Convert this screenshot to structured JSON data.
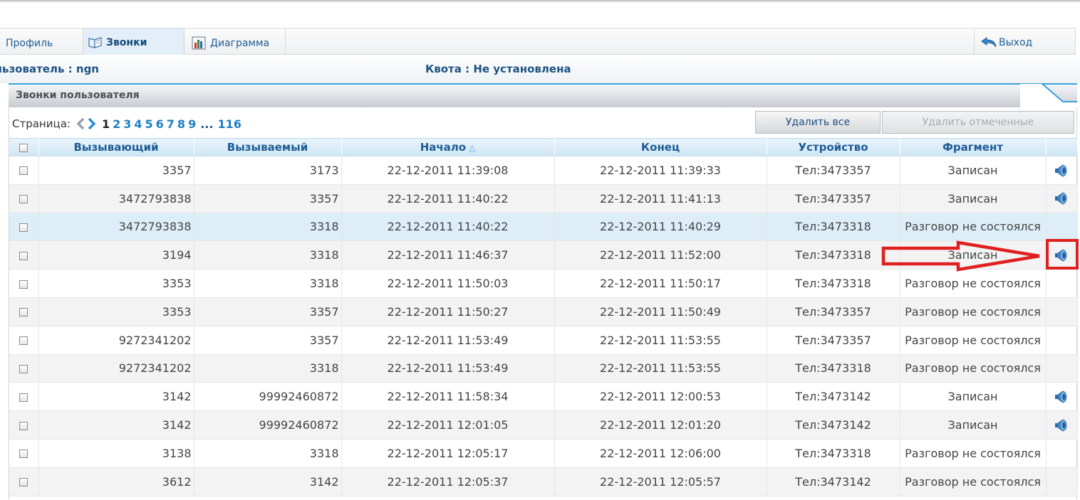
{
  "tabs": {
    "profile": "Профиль",
    "calls": "Звонки",
    "chart": "Диаграмма",
    "exit": "Выход"
  },
  "info": {
    "user": "льзователь : ngn",
    "quota": "Квота : Не установлена"
  },
  "panel": {
    "title": "Звонки пользователя"
  },
  "pager": {
    "label": "Страница:",
    "current": "1",
    "pages": [
      "2",
      "3",
      "4",
      "5",
      "6",
      "7",
      "8",
      "9"
    ],
    "dots": "...",
    "last": "116"
  },
  "buttons": {
    "delete_all": "Удалить все",
    "delete_checked": "Удалить отмеченные"
  },
  "table": {
    "headers": {
      "caller": "Вызывающий",
      "callee": "Вызываемый",
      "start": "Начало",
      "start_sort": "△",
      "end": "Конец",
      "device": "Устройство",
      "fragment": "Фрагмент"
    },
    "rows": [
      {
        "caller": "3357",
        "callee": "3173",
        "start": "22-12-2011 11:39:08",
        "end": "22-12-2011 11:39:33",
        "device": "Тел:3473357",
        "fragment": "Записан",
        "playable": true
      },
      {
        "caller": "3472793838",
        "callee": "3357",
        "start": "22-12-2011 11:40:22",
        "end": "22-12-2011 11:41:13",
        "device": "Тел:3473357",
        "fragment": "Записан",
        "playable": true
      },
      {
        "caller": "3472793838",
        "callee": "3318",
        "start": "22-12-2011 11:40:22",
        "end": "22-12-2011 11:40:29",
        "device": "Тел:3473318",
        "fragment": "Разговор не состоялся",
        "playable": false
      },
      {
        "caller": "3194",
        "callee": "3318",
        "start": "22-12-2011 11:46:37",
        "end": "22-12-2011 11:52:00",
        "device": "Тел:3473318",
        "fragment": "Записан",
        "playable": true
      },
      {
        "caller": "3353",
        "callee": "3318",
        "start": "22-12-2011 11:50:03",
        "end": "22-12-2011 11:50:17",
        "device": "Тел:3473318",
        "fragment": "Разговор не состоялся",
        "playable": false
      },
      {
        "caller": "3353",
        "callee": "3357",
        "start": "22-12-2011 11:50:27",
        "end": "22-12-2011 11:50:49",
        "device": "Тел:3473357",
        "fragment": "Разговор не состоялся",
        "playable": false
      },
      {
        "caller": "9272341202",
        "callee": "3357",
        "start": "22-12-2011 11:53:49",
        "end": "22-12-2011 11:53:55",
        "device": "Тел:3473357",
        "fragment": "Разговор не состоялся",
        "playable": false
      },
      {
        "caller": "9272341202",
        "callee": "3318",
        "start": "22-12-2011 11:53:49",
        "end": "22-12-2011 11:53:55",
        "device": "Тел:3473318",
        "fragment": "Разговор не состоялся",
        "playable": false
      },
      {
        "caller": "3142",
        "callee": "99992460872",
        "start": "22-12-2011 11:58:34",
        "end": "22-12-2011 12:00:53",
        "device": "Тел:3473142",
        "fragment": "Записан",
        "playable": true
      },
      {
        "caller": "3142",
        "callee": "99992460872",
        "start": "22-12-2011 12:01:05",
        "end": "22-12-2011 12:01:20",
        "device": "Тел:3473142",
        "fragment": "Записан",
        "playable": true
      },
      {
        "caller": "3138",
        "callee": "3318",
        "start": "22-12-2011 12:05:17",
        "end": "22-12-2011 12:06:00",
        "device": "Тел:3473318",
        "fragment": "Разговор не состоялся",
        "playable": false
      },
      {
        "caller": "3612",
        "callee": "3142",
        "start": "22-12-2011 12:05:37",
        "end": "22-12-2011 12:05:57",
        "device": "Тел:3473142",
        "fragment": "Разговор не состоялся",
        "playable": false
      }
    ]
  },
  "colors": {
    "accent_blue": "#1d7fc4",
    "recorded_green": "#2f9a2f",
    "highlight_red": "#e02020"
  }
}
